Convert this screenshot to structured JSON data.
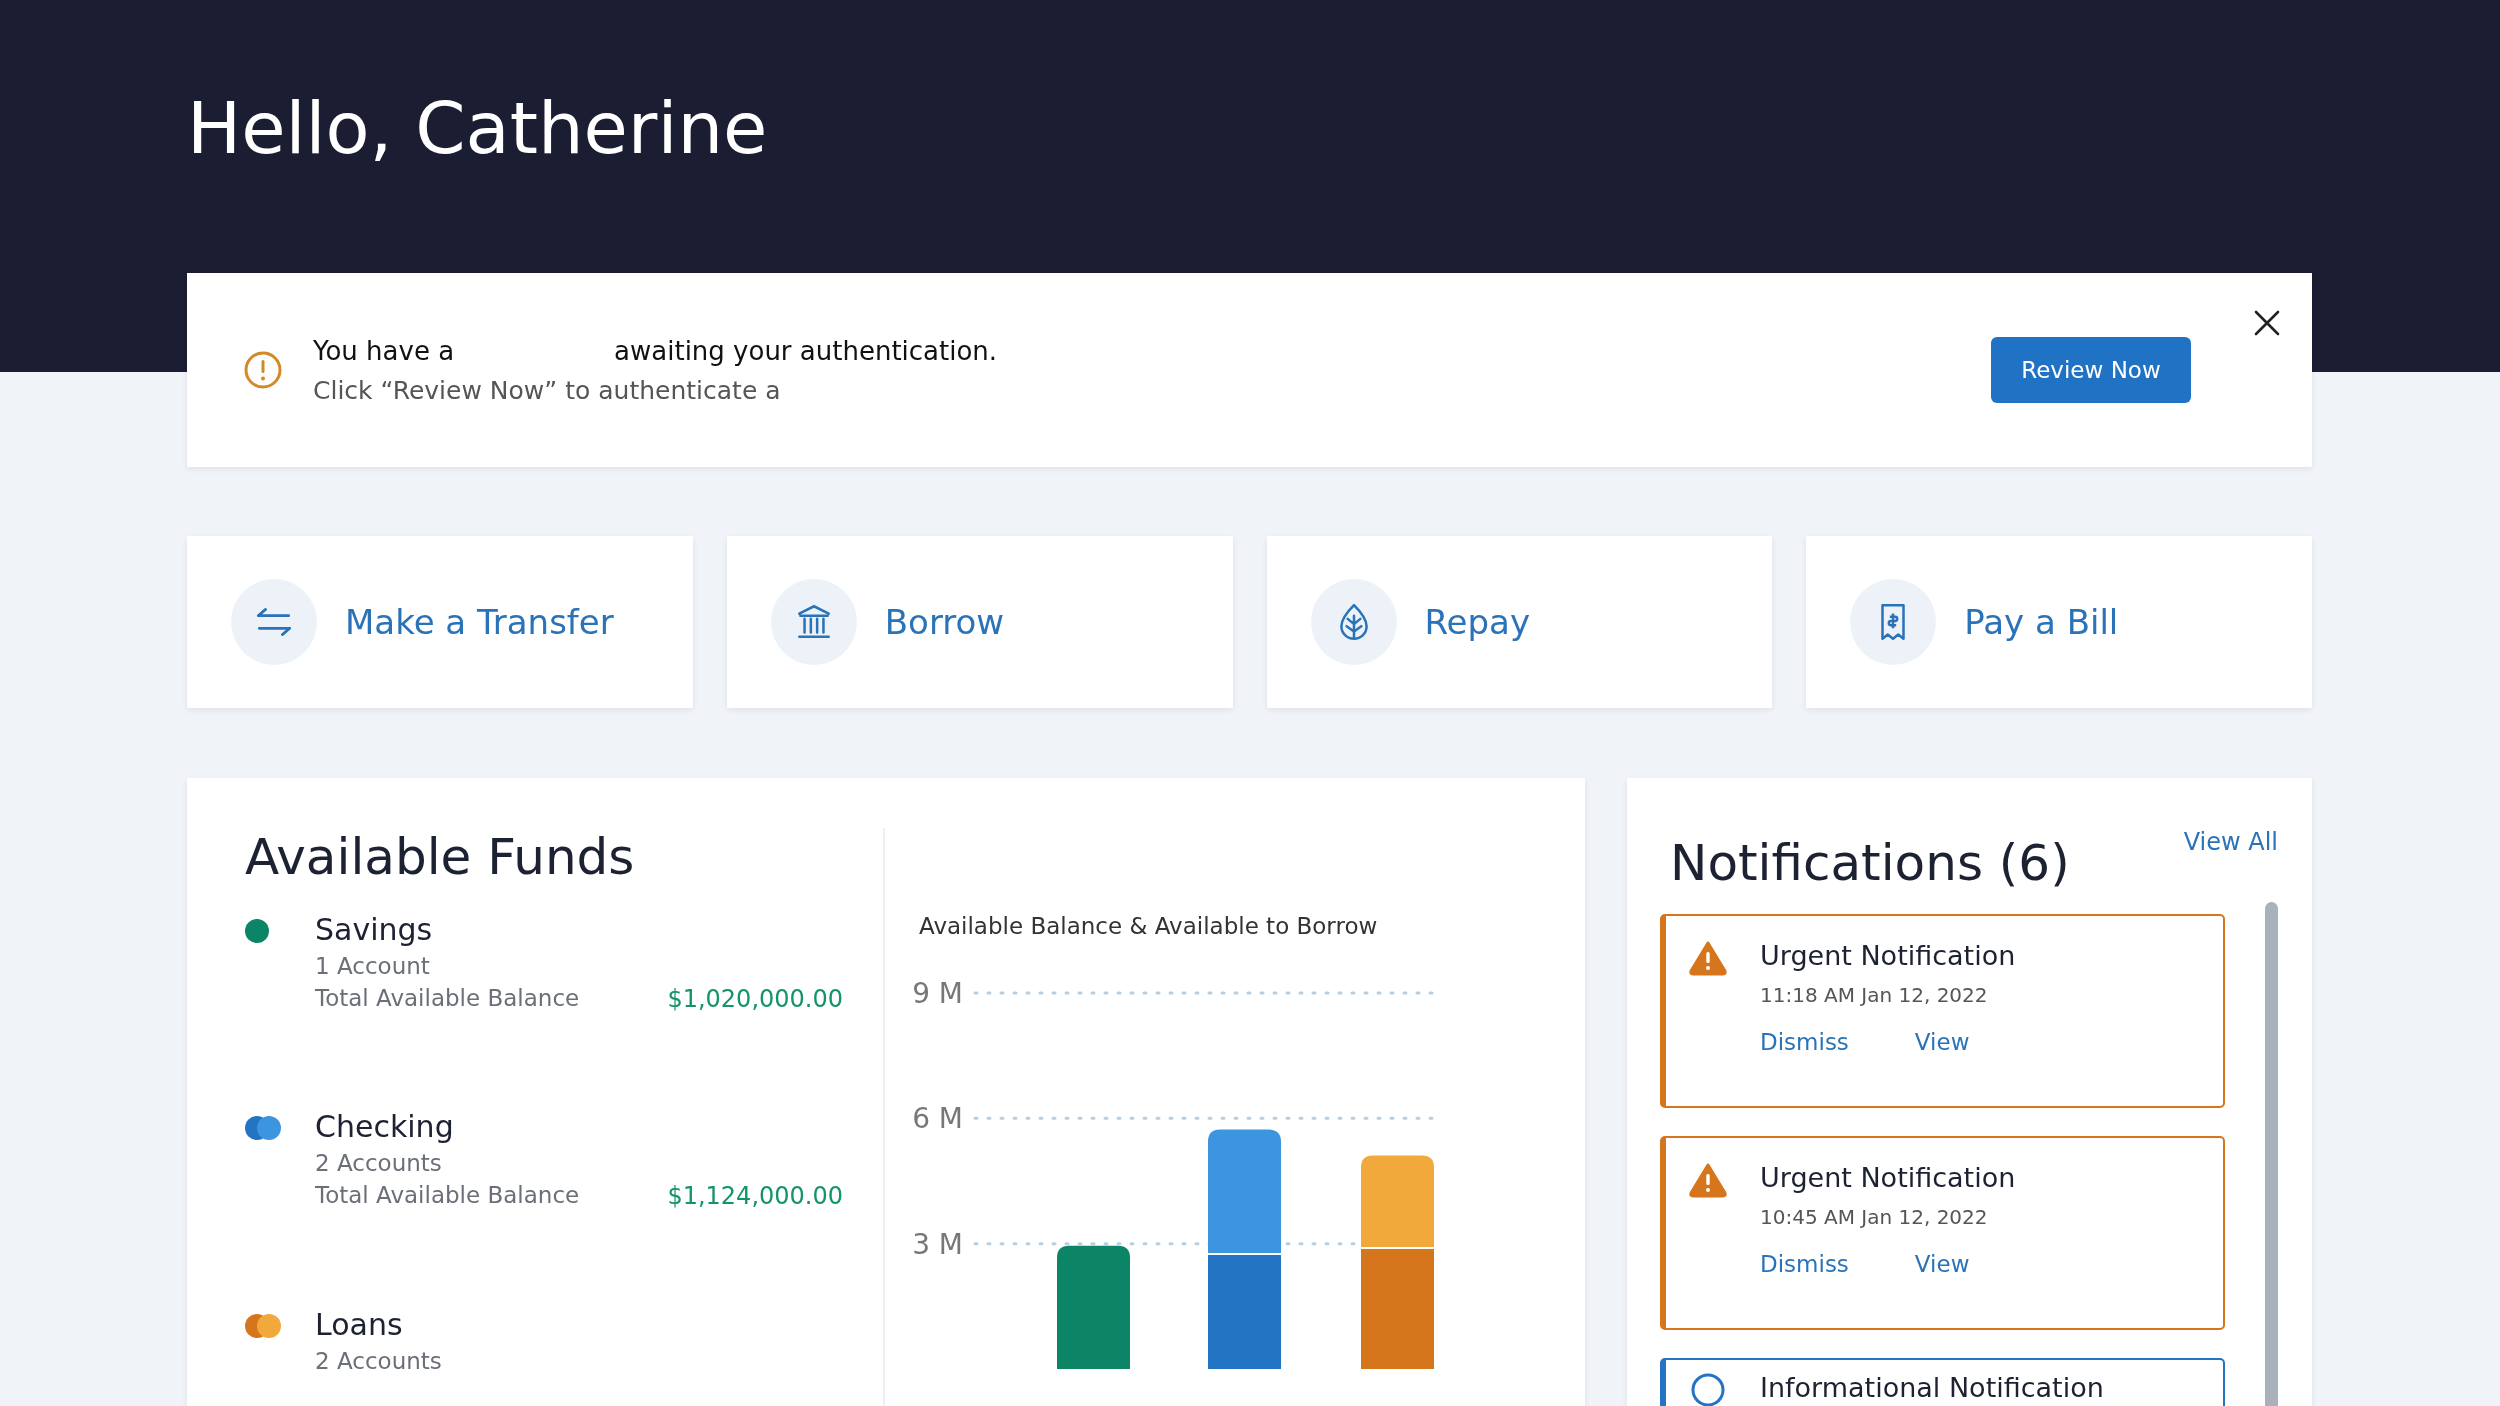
{
  "greeting": "Hello, Catherine",
  "alert": {
    "line_1_start": "You have a",
    "line_1_end": "awaiting your authentication.",
    "line_2": "Click “Review Now” to authenticate a",
    "button": "Review Now"
  },
  "actions": [
    {
      "kind": "transfer",
      "label": "Make a Transfer"
    },
    {
      "kind": "bank",
      "label": "Borrow"
    },
    {
      "kind": "leaf",
      "label": "Repay"
    },
    {
      "kind": "bill",
      "label": "Pay a Bill"
    }
  ],
  "funds": {
    "title": "Available Funds",
    "accounts": [
      {
        "name": "Savings",
        "count": "1 Account",
        "balance_label": "Total Available Balance",
        "balance": "$1,020,000.00",
        "color": "#0b8566"
      },
      {
        "name": "Checking",
        "count": "2 Accounts",
        "balance_label": "Total Available Balance",
        "balance": "$1,124,000.00",
        "color": "#2474c4"
      },
      {
        "name": "Loans",
        "count": "2 Accounts",
        "color": "#d6761c"
      }
    ],
    "chart_data": {
      "type": "bar",
      "title": "Available Balance & Available to Borrow",
      "stacked": true,
      "grid": true,
      "ylim": [
        0,
        9
      ],
      "yticks": [
        {
          "value": 3,
          "label": "3 M"
        },
        {
          "value": 6,
          "label": "6 M"
        },
        {
          "value": 9,
          "label": "9 M"
        }
      ],
      "series": [
        {
          "colors": [
            "#0b8566",
            "#2474c4",
            "#d6761c"
          ],
          "values": [
            2.95,
            2.73,
            2.87
          ]
        },
        {
          "colors": [
            null,
            "#3d95e0",
            "#f2a93b"
          ],
          "values": [
            null,
            3.0,
            2.24
          ]
        }
      ]
    }
  },
  "notifications": {
    "title": "Notifications (6)",
    "view_all": "View All",
    "items": [
      {
        "kind": "urgent",
        "title": "Urgent Notification",
        "time": "11:18 AM Jan 12, 2022",
        "actions": [
          "Dismiss",
          "View"
        ]
      },
      {
        "kind": "urgent",
        "title": "Urgent Notification",
        "time": "10:45 AM Jan 12, 2022",
        "actions": [
          "Dismiss",
          "View"
        ]
      },
      {
        "kind": "info",
        "title": "Informational Notification"
      }
    ]
  }
}
